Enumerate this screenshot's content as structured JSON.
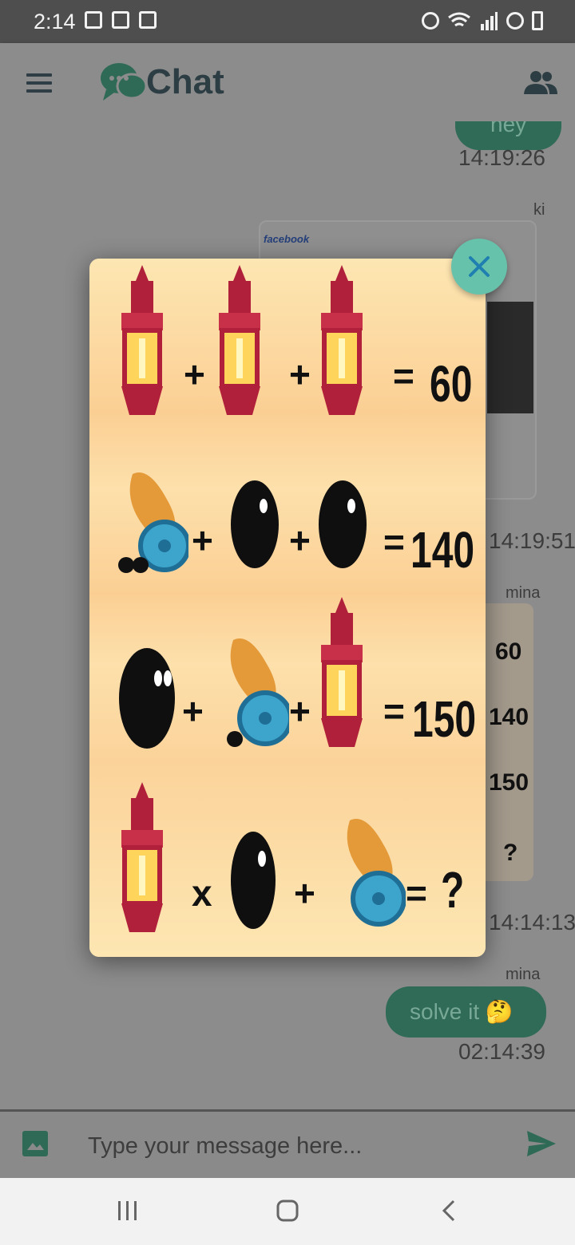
{
  "status_bar": {
    "time": "2:14"
  },
  "app_bar": {
    "title": "Chat"
  },
  "messages": [
    {
      "text": "hey",
      "time": "14:19:26"
    },
    {
      "sender": "ki",
      "time": "14:19:51"
    },
    {
      "sender": "mina",
      "time": "14:14:13"
    },
    {
      "sender": "mina",
      "text": "solve it 🤔",
      "time": "02:14:39"
    }
  ],
  "thumb_screenshot": {
    "app_label": "facebook"
  },
  "thumb_puzzle": {
    "values": [
      "60",
      "140",
      "150",
      "?"
    ]
  },
  "input": {
    "placeholder": "Type your message here..."
  },
  "puzzle": {
    "rows": [
      {
        "ops": [
          "+",
          "+",
          "="
        ],
        "result": "60"
      },
      {
        "ops": [
          "+",
          "+",
          "="
        ],
        "result": "140"
      },
      {
        "ops": [
          "+",
          "+",
          "="
        ],
        "result": "150"
      },
      {
        "ops": [
          "x",
          "+",
          "="
        ],
        "result": "?"
      }
    ]
  },
  "colors": {
    "accent": "#67c2ab",
    "bubble": "#2f6b57",
    "app_title": "#2c3e44"
  }
}
